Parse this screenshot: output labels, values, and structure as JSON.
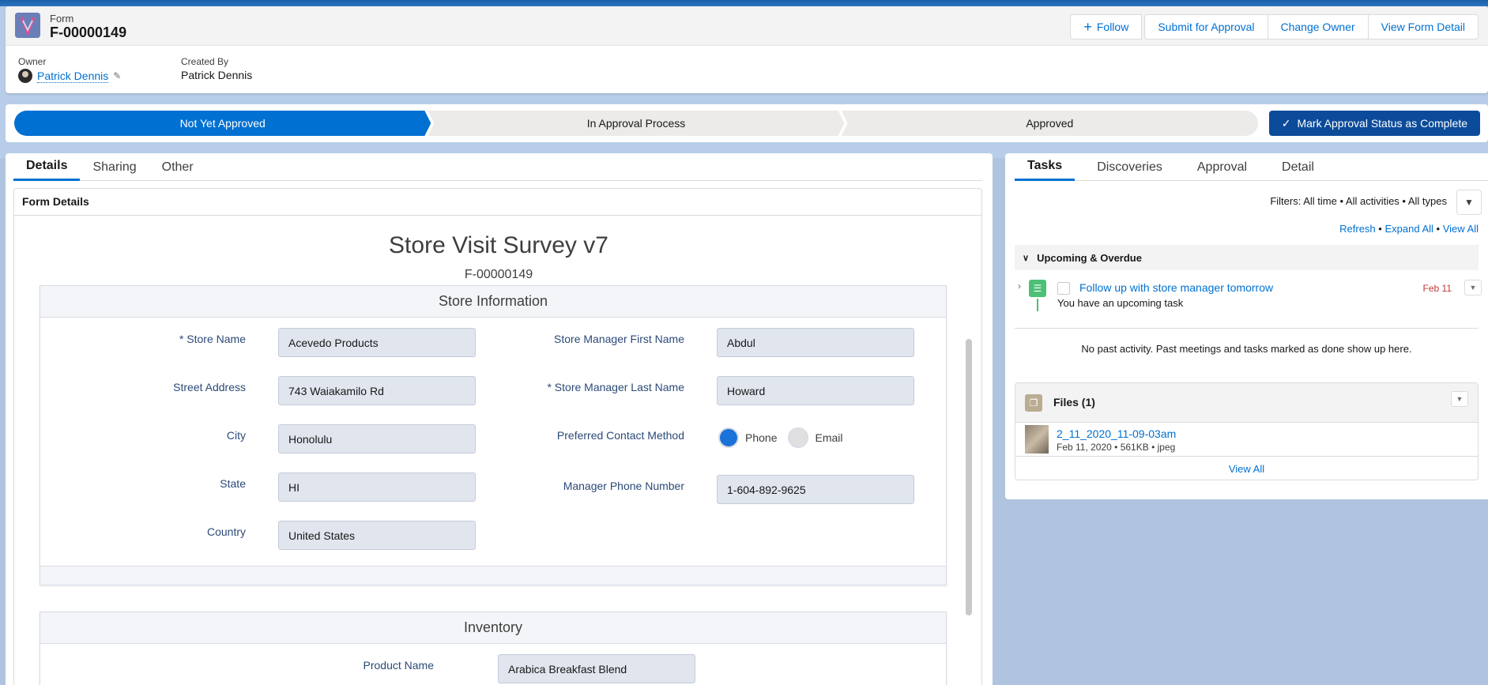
{
  "header": {
    "record_type": "Form",
    "record_name": "F-00000149",
    "actions": {
      "follow": "Follow",
      "submit": "Submit for Approval",
      "change_owner": "Change Owner",
      "view_detail": "View Form Detail"
    },
    "owner_label": "Owner",
    "owner_value": "Patrick Dennis",
    "created_by_label": "Created By",
    "created_by_value": "Patrick Dennis"
  },
  "path": {
    "stages": [
      "Not Yet Approved",
      "In Approval Process",
      "Approved"
    ],
    "current": "Not Yet Approved",
    "complete_button": "Mark Approval Status as Complete"
  },
  "left_tabs": [
    "Details",
    "Sharing",
    "Other"
  ],
  "form": {
    "card_title": "Form Details",
    "title": "Store Visit Survey v7",
    "number": "F-00000149",
    "store_section": {
      "title": "Store Information",
      "left_fields": [
        {
          "label": "* Store Name",
          "value": "Acevedo Products"
        },
        {
          "label": "Street Address",
          "value": "743 Waiakamilo Rd"
        },
        {
          "label": "City",
          "value": "Honolulu"
        },
        {
          "label": "State",
          "value": "HI"
        },
        {
          "label": "Country",
          "value": "United States"
        }
      ],
      "right_fields": {
        "first_name": {
          "label": "Store Manager First Name",
          "value": "Abdul"
        },
        "last_name": {
          "label": "* Store Manager Last Name",
          "value": "Howard"
        },
        "contact": {
          "label": "Preferred Contact Method",
          "options": [
            "Phone",
            "Email"
          ],
          "selected": "Phone"
        },
        "phone": {
          "label": "Manager Phone Number",
          "value": "1-604-892-9625"
        }
      }
    },
    "inventory_section": {
      "title": "Inventory",
      "product_label": "Product Name",
      "product_value": "Arabica Breakfast Blend"
    }
  },
  "right_tabs": [
    "Tasks",
    "Discoveries",
    "Approval",
    "Detail"
  ],
  "activity": {
    "filters": "Filters: All time • All activities • All types",
    "refresh": "Refresh",
    "expand_all": "Expand All",
    "view_all": "View All",
    "upcoming": "Upcoming & Overdue",
    "task_title": "Follow up with store manager tomorrow",
    "task_sub": "You have an upcoming task",
    "task_date": "Feb 11",
    "no_past": "No past activity. Past meetings and tasks marked as done show up here."
  },
  "files": {
    "title": "Files (1)",
    "file_name": "2_11_2020_11-09-03am",
    "file_meta": "Feb 11, 2020 • 561KB • jpeg",
    "view_all": "View All"
  }
}
